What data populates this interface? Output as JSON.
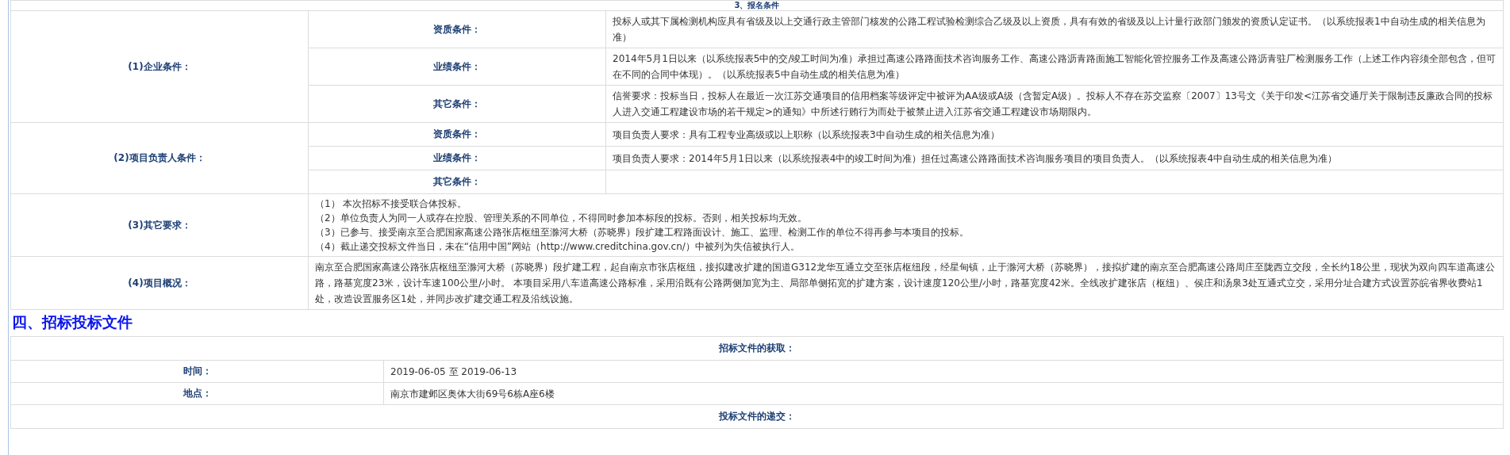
{
  "section_header": "3、报名条件",
  "conditions": [
    {
      "label": "(1)企业条件：",
      "items": [
        {
          "label": "资质条件：",
          "text": "投标人或其下属检测机构应具有省级及以上交通行政主管部门核发的公路工程试验检测综合乙级及以上资质，具有有效的省级及以上计量行政部门颁发的资质认定证书。（以系统报表1中自动生成的相关信息为准）"
        },
        {
          "label": "业绩条件：",
          "text": "2014年5月1日以来（以系统报表5中的交/竣工时间为准）承担过高速公路路面技术咨询服务工作、高速公路沥青路面施工智能化管控服务工作及高速公路沥青驻厂检测服务工作（上述工作内容须全部包含，但可在不同的合同中体现）。（以系统报表5中自动生成的相关信息为准）"
        },
        {
          "label": "其它条件：",
          "text": "信誉要求：投标当日，投标人在最近一次江苏交通项目的信用档案等级评定中被评为AA级或A级（含暂定A级）。投标人不存在苏交监察〔2007〕13号文《关于印发<江苏省交通厅关于限制违反廉政合同的投标人进入交通工程建设市场的若干规定>的通知》中所述行贿行为而处于被禁止进入江苏省交通工程建设市场期限内。"
        }
      ]
    },
    {
      "label": "(2)项目负责人条件：",
      "items": [
        {
          "label": "资质条件：",
          "text": "项目负责人要求：具有工程专业高级或以上职称（以系统报表3中自动生成的相关信息为准）"
        },
        {
          "label": "业绩条件：",
          "text": "项目负责人要求：2014年5月1日以来（以系统报表4中的竣工时间为准）担任过高速公路路面技术咨询服务项目的项目负责人。（以系统报表4中自动生成的相关信息为准）"
        },
        {
          "label": "其它条件："
        }
      ]
    }
  ],
  "other_requirements": {
    "label": "(3)其它要求：",
    "lines": [
      "（1） 本次招标不接受联合体投标。",
      "（2）单位负责人为同一人或存在控股、管理关系的不同单位，不得同时参加本标段的投标。否则，相关投标均无效。",
      "（3）已参与、接受南京至合肥国家高速公路张店枢纽至滁河大桥（苏晓界）段扩建工程路面设计、施工、监理、检测工作的单位不得再参与本项目的投标。",
      "（4）截止递交投标文件当日，未在“信用中国”网站（http://www.creditchina.gov.cn/）中被列为失信被执行人。"
    ]
  },
  "overview": {
    "label": "(4)项目概况：",
    "text": "南京至合肥国家高速公路张店枢纽至滁河大桥（苏晓界）段扩建工程，起自南京市张店枢纽，接拟建改扩建的国道G312龙华互通立交至张店枢纽段，经星甸镇，止于滁河大桥（苏晓界），接拟扩建的南京至合肥高速公路周庄至陇西立交段，全长约18公里，现状为双向四车道高速公路，路基宽度23米，设计车速100公里/小时。 本项目采用八车道高速公路标准，采用沿既有公路两侧加宽为主、局部单侧拓宽的扩建方案，设计速度120公里/小时，路基宽度42米。全线改扩建张店（枢纽）、侯庄和汤泉3处互通式立交，采用分址合建方式设置苏皖省界收费站1处，改造设置服务区1处，并同步改扩建交通工程及沿线设施。"
  },
  "section_title": "四、招标投标文件",
  "documents": [
    {
      "title": "招标文件的获取：",
      "rows": [
        {
          "label": "时间：",
          "value": "2019-06-05 至 2019-06-13"
        },
        {
          "label": "地点：",
          "value": "南京市建邺区奥体大街69号6栋A座6楼"
        }
      ]
    },
    {
      "title": "投标文件的递交："
    }
  ]
}
